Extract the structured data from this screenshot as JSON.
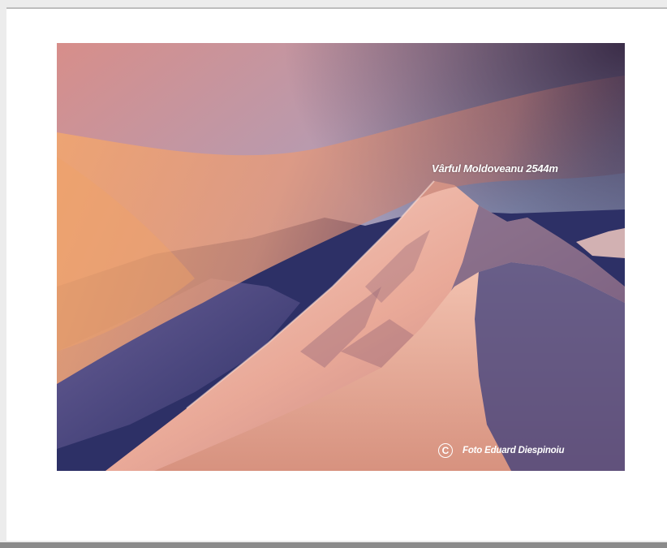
{
  "photo": {
    "peak_label": "Vârful Moldoveanu 2544m",
    "credit_symbol": "C",
    "credit_text": "Foto Eduard  Diespinoiu",
    "icons": [
      "copyright-icon"
    ],
    "colors": {
      "sky_warm": "#e6a088",
      "sky_cool": "#8a9ac0",
      "snow_lit": "#f2c6b8",
      "snow_shadow": "#3b3f7c",
      "mist": "#d98a6a"
    }
  }
}
